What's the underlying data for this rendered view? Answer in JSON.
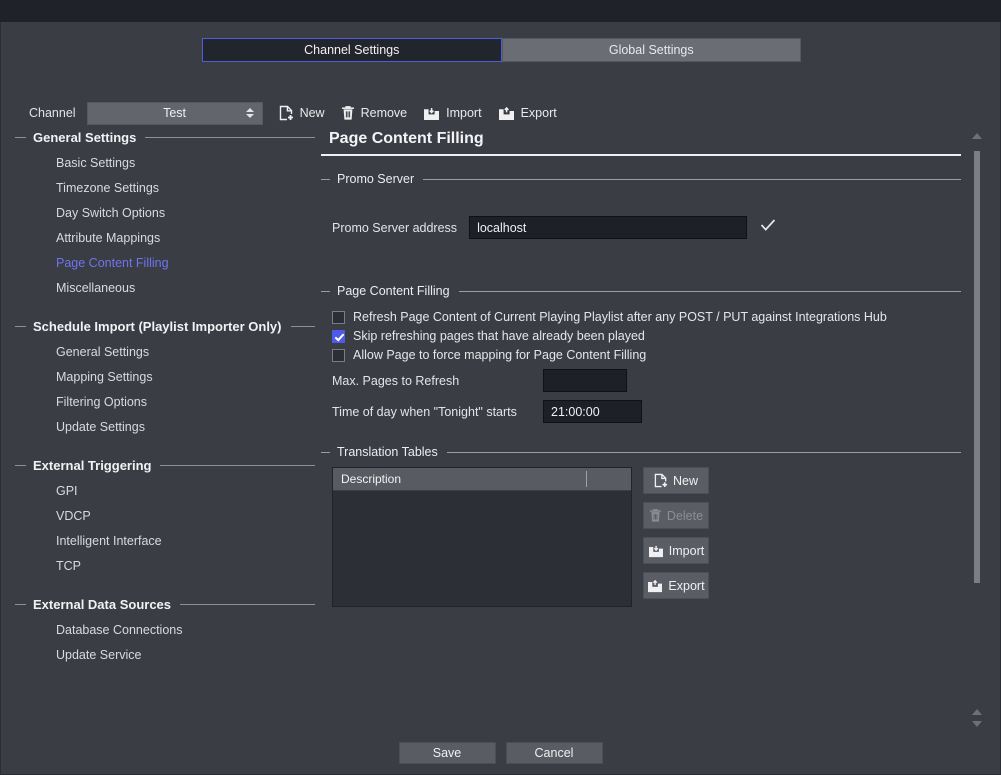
{
  "window": {
    "title": ""
  },
  "tabs": [
    {
      "label": "Channel Settings",
      "active": true
    },
    {
      "label": "Global Settings",
      "active": false
    }
  ],
  "toolbar": {
    "channel_label": "Channel",
    "channel_value": "Test",
    "buttons": [
      {
        "label": "New",
        "icon": "new-document-icon"
      },
      {
        "label": "Remove",
        "icon": "trash-icon"
      },
      {
        "label": "Import",
        "icon": "import-folder-icon"
      },
      {
        "label": "Export",
        "icon": "export-folder-icon"
      }
    ]
  },
  "sidebar": {
    "groups": [
      {
        "title": "General Settings",
        "items": [
          {
            "label": "Basic Settings",
            "active": false
          },
          {
            "label": "Timezone Settings",
            "active": false
          },
          {
            "label": "Day Switch Options",
            "active": false
          },
          {
            "label": "Attribute Mappings",
            "active": false
          },
          {
            "label": "Page Content Filling",
            "active": true
          },
          {
            "label": "Miscellaneous",
            "active": false
          }
        ]
      },
      {
        "title": "Schedule Import (Playlist Importer Only)",
        "items": [
          {
            "label": "General Settings",
            "active": false
          },
          {
            "label": "Mapping Settings",
            "active": false
          },
          {
            "label": "Filtering Options",
            "active": false
          },
          {
            "label": "Update Settings",
            "active": false
          }
        ]
      },
      {
        "title": "External Triggering",
        "items": [
          {
            "label": "GPI",
            "active": false
          },
          {
            "label": "VDCP",
            "active": false
          },
          {
            "label": "Intelligent Interface",
            "active": false
          },
          {
            "label": "TCP",
            "active": false
          }
        ]
      },
      {
        "title": "External Data Sources",
        "items": [
          {
            "label": "Database Connections",
            "active": false
          },
          {
            "label": "Update Service",
            "active": false
          }
        ]
      }
    ]
  },
  "main": {
    "page_title": "Page Content Filling",
    "promo_server": {
      "legend": "Promo Server",
      "address_label": "Promo Server address",
      "address_value": "localhost",
      "validated_icon": "checkmark-icon"
    },
    "page_content_filling": {
      "legend": "Page Content Filling",
      "checkboxes": [
        {
          "label": "Refresh Page Content of Current Playing Playlist after any POST / PUT against Integrations Hub",
          "checked": false
        },
        {
          "label": "Skip refreshing pages that have already been played",
          "checked": true
        },
        {
          "label": "Allow Page to force mapping for Page Content Filling",
          "checked": false
        }
      ],
      "max_pages_label": "Max. Pages to Refresh",
      "max_pages_value": "",
      "tonight_label": "Time of day when \"Tonight\" starts",
      "tonight_value": "21:00:00"
    },
    "translation_tables": {
      "legend": "Translation Tables",
      "column_header": "Description",
      "rows": [],
      "buttons": [
        {
          "label": "New",
          "icon": "new-document-icon",
          "disabled": false
        },
        {
          "label": "Delete",
          "icon": "trash-icon",
          "disabled": true
        },
        {
          "label": "Import",
          "icon": "import-folder-icon",
          "disabled": false
        },
        {
          "label": "Export",
          "icon": "export-folder-icon",
          "disabled": false
        }
      ]
    }
  },
  "footer": {
    "save_label": "Save",
    "cancel_label": "Cancel"
  },
  "colors": {
    "accent": "#4e5ae8",
    "active_nav": "#6f74ee",
    "window_bg": "#3a3d44",
    "input_bg": "#1d2026"
  }
}
